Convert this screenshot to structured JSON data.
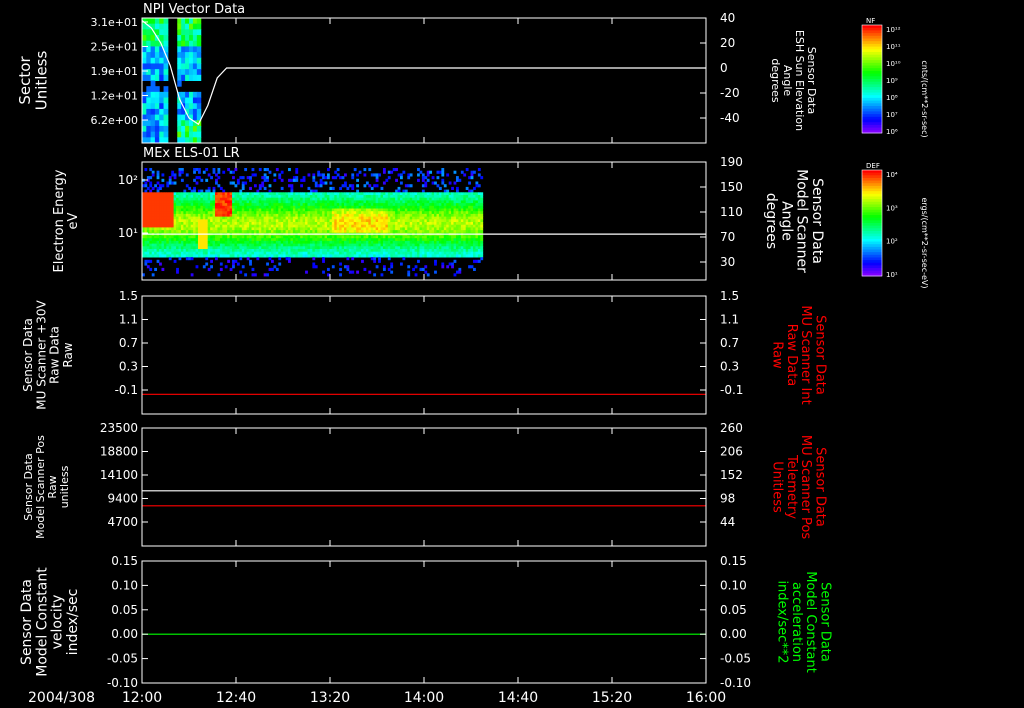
{
  "time_axis": {
    "date": "2004/308",
    "ticks": [
      "12:00",
      "12:40",
      "13:20",
      "14:00",
      "14:40",
      "15:20",
      "16:00"
    ],
    "start_minutes": 720,
    "end_minutes": 960
  },
  "colors": {
    "background": "#000000",
    "axes": "#ffffff",
    "red": "#ff0000",
    "green": "#00ff00"
  },
  "colorbars": [
    {
      "top_label": "NF",
      "max_label": "10¹²",
      "min_label": "10⁶",
      "tick_labels": [
        "10¹²",
        "10¹¹",
        "10¹⁰",
        "10⁹",
        "10⁸",
        "10⁷",
        "10⁶"
      ],
      "unit_label": "cnts/(cm**2-sr-sec)"
    },
    {
      "top_label": "DEF",
      "max_label": "10⁴",
      "min_label": "10¹",
      "tick_labels": [
        "10⁴",
        "10³",
        "10²",
        "10¹"
      ],
      "unit_label": "ergs/(cm**2-sr-sec-eV)"
    }
  ],
  "chart_data": [
    {
      "type": "heatmap",
      "title": "NPI Vector Data",
      "ylabel_lines": [
        "Sector",
        "Unitless"
      ],
      "yticks": [
        "3.1e+01",
        "2.5e+01",
        "1.9e+01",
        "1.2e+01",
        "6.2e+00"
      ],
      "right_label_lines": [
        "Sensor Data",
        "ESH Sun Elevation",
        "Angle",
        "degrees"
      ],
      "right_ticks": [
        "40",
        "20",
        "0",
        "-20",
        "-40"
      ],
      "right_ylim": [
        -60,
        40
      ],
      "blocks": [
        {
          "t_start": 720,
          "t_end": 731
        },
        {
          "t_start": 735,
          "t_end": 745
        }
      ],
      "series": [
        {
          "color": "white",
          "axis": "right",
          "x": [
            720,
            724,
            728,
            732,
            736,
            740,
            744,
            748,
            752,
            756,
            760,
            1080
          ],
          "y": [
            38,
            32,
            20,
            2,
            -25,
            -40,
            -45,
            -30,
            -8,
            0,
            0,
            0
          ]
        }
      ]
    },
    {
      "type": "heatmap",
      "title": "MEx ELS-01 LR",
      "ylabel_lines": [
        "Electron Energy",
        "eV"
      ],
      "yticks": [
        "10²",
        "10¹"
      ],
      "ylim": [
        1.5,
        200
      ],
      "yscale": "log",
      "right_label_lines": [
        "Sensor Data",
        "Model Scanner",
        "Angle",
        "degrees"
      ],
      "right_ticks": [
        "190",
        "150",
        "110",
        "70",
        "30"
      ],
      "right_ylim": [
        10,
        190
      ],
      "data_end_time": 865,
      "series": [
        {
          "color": "white",
          "axis": "right",
          "x": [
            720,
            960
          ],
          "y": [
            80,
            80
          ]
        }
      ]
    },
    {
      "type": "line",
      "ylabel_lines": [
        "Sensor Data",
        "MU Scanner +30V",
        "Raw Data",
        "Raw"
      ],
      "yticks": [
        "1.5",
        "1.1",
        "0.7",
        "0.3",
        "-0.1"
      ],
      "ylim": [
        -0.3,
        1.5
      ],
      "right_label_lines": [
        "Sensor Data",
        "MU Scanner Int",
        "Raw Data",
        "Raw"
      ],
      "right_ticks": [
        "1.5",
        "1.1",
        "0.7",
        "0.3",
        "-0.1"
      ],
      "right_label_color": "red",
      "series": [
        {
          "color": "red",
          "x": [
            720,
            960
          ],
          "y": [
            0.0,
            0.0
          ]
        }
      ]
    },
    {
      "type": "line",
      "ylabel_lines": [
        "Sensor Data",
        "Model Scanner Pos",
        "Raw",
        "unitless"
      ],
      "yticks": [
        "23500",
        "18800",
        "14100",
        "9400",
        "4700"
      ],
      "ylim": [
        0,
        23500
      ],
      "right_label_lines": [
        "Sensor Data",
        "MU Scanner Pos",
        "Telemetry",
        "Unitless"
      ],
      "right_ticks": [
        "260",
        "206",
        "152",
        "98",
        "44"
      ],
      "right_label_color": "red",
      "series": [
        {
          "color": "white",
          "x": [
            720,
            960
          ],
          "y": [
            11000,
            11000
          ]
        },
        {
          "color": "red",
          "x": [
            720,
            960
          ],
          "y": [
            8000,
            8000
          ]
        }
      ]
    },
    {
      "type": "line",
      "ylabel_lines": [
        "Sensor Data",
        "Model Constant",
        "velocity",
        "index/sec"
      ],
      "yticks": [
        "0.15",
        "0.10",
        "0.05",
        "0.00",
        "-0.05",
        "-0.10"
      ],
      "ylim": [
        -0.1,
        0.15
      ],
      "right_label_lines": [
        "Sensor Data",
        "Model Constant",
        "acceleration",
        "index/sec**2"
      ],
      "right_ticks": [
        "0.15",
        "0.10",
        "0.05",
        "0.00",
        "-0.05",
        "-0.10"
      ],
      "right_label_color": "green",
      "series": [
        {
          "color": "green",
          "x": [
            720,
            960
          ],
          "y": [
            0.0,
            0.0
          ]
        }
      ]
    }
  ]
}
